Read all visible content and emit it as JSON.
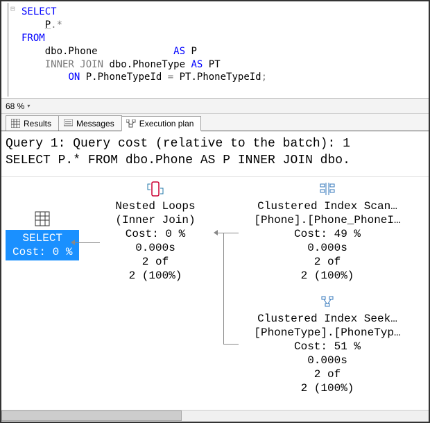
{
  "sql": {
    "line1_kw": "SELECT",
    "line2_text": "P",
    "line2_star": ".*",
    "line3_kw": "FROM",
    "line4_obj": "dbo.Phone",
    "line4_as": "AS",
    "line4_alias": "P",
    "line5_join": "INNER JOIN",
    "line5_obj": "dbo.PhoneType",
    "line5_as": "AS",
    "line5_alias": "PT",
    "line6_on": "ON",
    "line6_left": "P.PhoneTypeId",
    "line6_eq": " = ",
    "line6_right": "PT.PhoneTypeId",
    "line6_semi": ";"
  },
  "zoom": {
    "value": "68 %"
  },
  "tabs": {
    "results": "Results",
    "messages": "Messages",
    "plan": "Execution plan"
  },
  "plan_header": {
    "row1": "Query 1: Query cost (relative to the batch): 1",
    "row2": "SELECT P.* FROM dbo.Phone AS P INNER JOIN dbo."
  },
  "nodes": {
    "select": {
      "title": "SELECT",
      "cost": "Cost: 0 %"
    },
    "nested": {
      "title1": "Nested Loops",
      "title2": "(Inner Join)",
      "cost": "Cost: 0 %",
      "time": "0.000s",
      "rows1": "2 of",
      "rows2": "2 (100%)"
    },
    "scan": {
      "title1": "Clustered Index Scan…",
      "title2": "[Phone].[Phone_PhoneI…",
      "cost": "Cost: 49 %",
      "time": "0.000s",
      "rows1": "2 of",
      "rows2": "2 (100%)"
    },
    "seek": {
      "title1": "Clustered Index Seek…",
      "title2": "[PhoneType].[PhoneTyp…",
      "cost": "Cost: 51 %",
      "time": "0.000s",
      "rows1": "2 of",
      "rows2": "2 (100%)"
    }
  }
}
